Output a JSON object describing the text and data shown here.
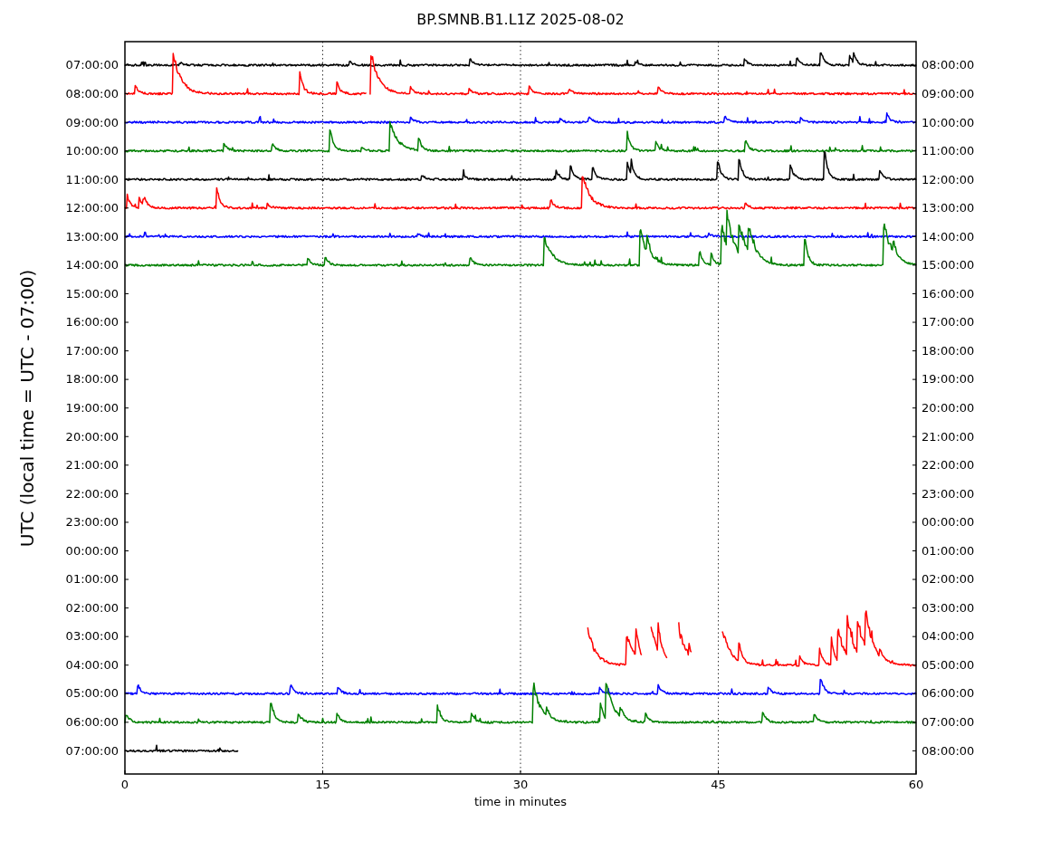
{
  "title": "BP.SMNB.B1.L1Z 2025-08-02",
  "y_label": "UTC (local time = UTC - 07:00)",
  "x_label": "time in minutes",
  "x_ticks": [
    "0",
    "15",
    "30",
    "45",
    "60"
  ],
  "rows": [
    {
      "left": "07:00:00",
      "right": "08:00:00",
      "trace": {
        "color": "#000000"
      }
    },
    {
      "left": "08:00:00",
      "right": "09:00:00",
      "trace": {
        "color": "#ff0000"
      }
    },
    {
      "left": "09:00:00",
      "right": "10:00:00",
      "trace": {
        "color": "#0000ff"
      }
    },
    {
      "left": "10:00:00",
      "right": "11:00:00",
      "trace": {
        "color": "#008000"
      }
    },
    {
      "left": "11:00:00",
      "right": "12:00:00",
      "trace": {
        "color": "#000000"
      }
    },
    {
      "left": "12:00:00",
      "right": "13:00:00",
      "trace": {
        "color": "#ff0000"
      }
    },
    {
      "left": "13:00:00",
      "right": "14:00:00",
      "trace": {
        "color": "#0000ff"
      }
    },
    {
      "left": "14:00:00",
      "right": "15:00:00",
      "trace": {
        "color": "#008000"
      }
    },
    {
      "left": "15:00:00",
      "right": "16:00:00"
    },
    {
      "left": "16:00:00",
      "right": "17:00:00"
    },
    {
      "left": "17:00:00",
      "right": "18:00:00"
    },
    {
      "left": "18:00:00",
      "right": "19:00:00"
    },
    {
      "left": "19:00:00",
      "right": "20:00:00"
    },
    {
      "left": "20:00:00",
      "right": "21:00:00"
    },
    {
      "left": "21:00:00",
      "right": "22:00:00"
    },
    {
      "left": "22:00:00",
      "right": "23:00:00"
    },
    {
      "left": "23:00:00",
      "right": "00:00:00"
    },
    {
      "left": "00:00:00",
      "right": "01:00:00"
    },
    {
      "left": "01:00:00",
      "right": "02:00:00"
    },
    {
      "left": "02:00:00",
      "right": "03:00:00"
    },
    {
      "left": "03:00:00",
      "right": "04:00:00"
    },
    {
      "left": "04:00:00",
      "right": "05:00:00",
      "trace": {
        "color": "#ff0000"
      }
    },
    {
      "left": "05:00:00",
      "right": "06:00:00",
      "trace": {
        "color": "#0000ff"
      }
    },
    {
      "left": "06:00:00",
      "right": "07:00:00",
      "trace": {
        "color": "#008000"
      }
    },
    {
      "left": "07:00:00",
      "right": "08:00:00",
      "trace": {
        "color": "#000000"
      }
    }
  ]
}
